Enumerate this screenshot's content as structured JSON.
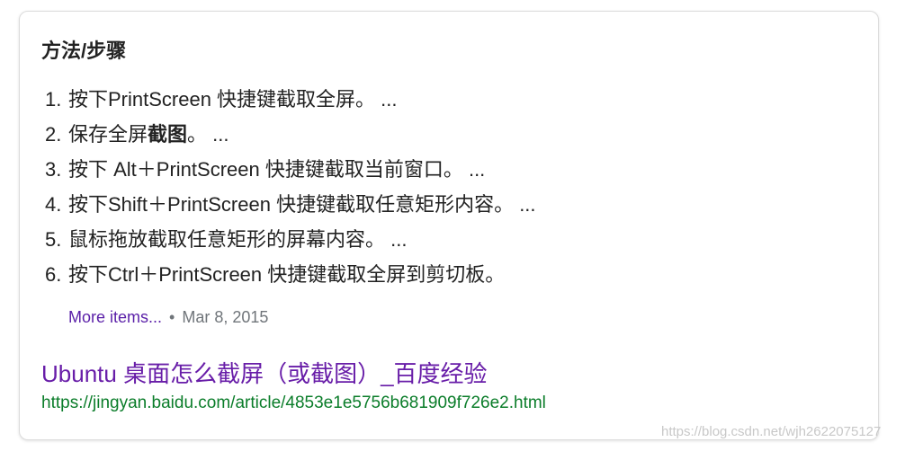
{
  "section": {
    "heading": "方法/步骤"
  },
  "steps": [
    {
      "num": "1.",
      "pre": "按下PrintScreen 快捷键截取全屏。 ...",
      "bold": "",
      "post": ""
    },
    {
      "num": "2.",
      "pre": "保存全屏",
      "bold": "截图",
      "post": "。 ..."
    },
    {
      "num": "3.",
      "pre": "按下 Alt＋PrintScreen 快捷键截取当前窗口。 ...",
      "bold": "",
      "post": ""
    },
    {
      "num": "4.",
      "pre": "按下Shift＋PrintScreen 快捷键截取任意矩形内容。 ...",
      "bold": "",
      "post": ""
    },
    {
      "num": "5.",
      "pre": "鼠标拖放截取任意矩形的屏幕内容。 ...",
      "bold": "",
      "post": ""
    },
    {
      "num": "6.",
      "pre": "按下Ctrl＋PrintScreen 快捷键截取全屏到剪切板。",
      "bold": "",
      "post": ""
    }
  ],
  "meta": {
    "more_label": "More items...",
    "separator": "•",
    "date": "Mar 8, 2015"
  },
  "result": {
    "title": "Ubuntu 桌面怎么截屏（或截图）_百度经验",
    "url": "https://jingyan.baidu.com/article/4853e1e5756b681909f726e2.html"
  },
  "watermark": "https://blog.csdn.net/wjh2622075127",
  "colors": {
    "visited_link": "#681da8",
    "url_green": "#0b7d2a",
    "meta_gray": "#70757a"
  }
}
